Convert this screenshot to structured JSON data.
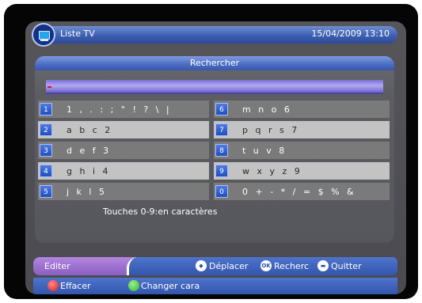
{
  "header": {
    "title": "Liste TV",
    "datetime": "15/04/2009 13:10",
    "icon": "tv-icon"
  },
  "dialog": {
    "title": "Rechercher",
    "search_value": "",
    "keys": [
      {
        "num": "1",
        "chars": "1 , . : ; \" ! ? \\ |"
      },
      {
        "num": "2",
        "chars": "a b c 2"
      },
      {
        "num": "3",
        "chars": "d e f 3"
      },
      {
        "num": "4",
        "chars": "g h i 4"
      },
      {
        "num": "5",
        "chars": "j k l 5"
      },
      {
        "num": "6",
        "chars": "m n o 6"
      },
      {
        "num": "7",
        "chars": "p q r s 7"
      },
      {
        "num": "8",
        "chars": "t u v 8"
      },
      {
        "num": "9",
        "chars": "w x y z 9"
      },
      {
        "num": "0",
        "chars": "0 + - * / = $ % &"
      }
    ],
    "hint": "Touches 0-9:en caractères"
  },
  "footer": {
    "edit_label": "Editer",
    "move_label": "Déplacer",
    "search_label": "Recherc",
    "quit_label": "Quitter",
    "ok_icon_text": "OK",
    "erase_label": "Effacer",
    "change_label": "Changer cara"
  },
  "colors": {
    "accent_blue": "#3d5fb2",
    "highlight_purple": "#9b6fd0",
    "red_button": "#d42020",
    "green_button": "#2fb52b"
  }
}
